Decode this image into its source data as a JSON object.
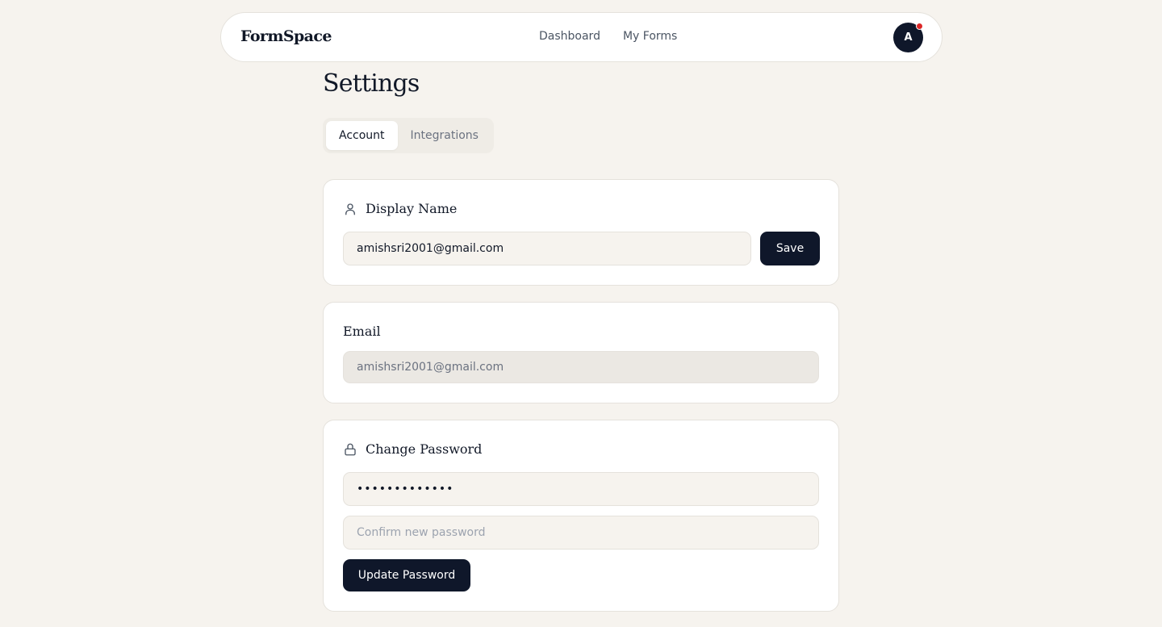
{
  "app": {
    "brand": "FormSpace"
  },
  "nav": {
    "links": [
      {
        "label": "Dashboard"
      },
      {
        "label": "My Forms"
      }
    ],
    "avatar_initial": "A"
  },
  "page": {
    "title": "Settings"
  },
  "tabs": [
    {
      "label": "Account",
      "active": true
    },
    {
      "label": "Integrations",
      "active": false
    }
  ],
  "display_name_card": {
    "title": "Display Name",
    "icon": "user-icon",
    "value": "amishsri2001@gmail.com",
    "save_label": "Save"
  },
  "email_card": {
    "title": "Email",
    "value": "amishsri2001@gmail.com"
  },
  "password_card": {
    "title": "Change Password",
    "icon": "lock-icon",
    "new_password_value": "•••••••••••••",
    "confirm_placeholder": "Confirm new password",
    "update_label": "Update Password"
  },
  "colors": {
    "background": "#f6f3ee",
    "accent": "#0f172a",
    "notification": "#dc2626"
  }
}
